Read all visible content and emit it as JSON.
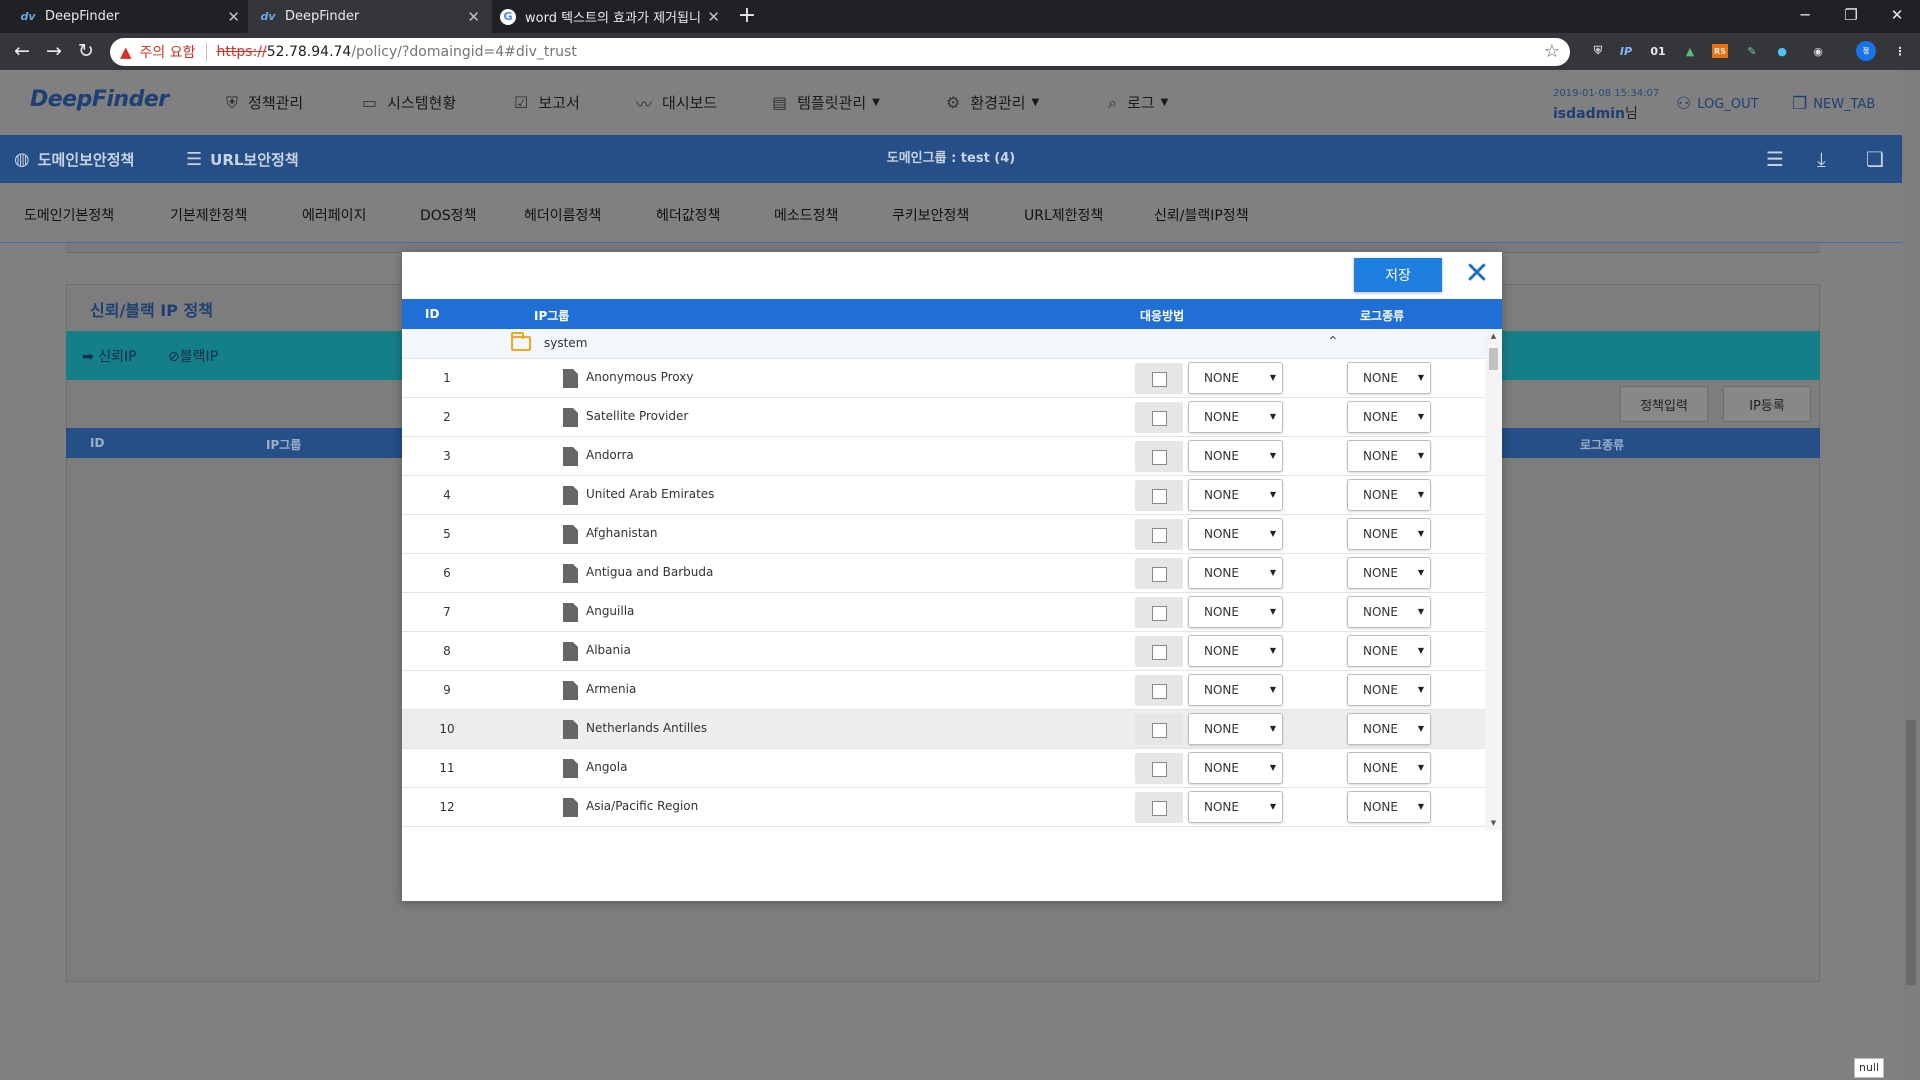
{
  "browser": {
    "tabs": [
      {
        "title": "DeepFinder",
        "favicon": "deepfinder-favicon",
        "active": false
      },
      {
        "title": "DeepFinder",
        "favicon": "deepfinder-favicon",
        "active": true
      },
      {
        "title": "word 텍스트의 효과가 제거됩니",
        "favicon": "google-favicon",
        "active": false
      }
    ],
    "security_warning": "주의 요함",
    "url_protocol": "https://",
    "url_host": "52.78.94.74",
    "url_path": "/policy/?domaingid=4#div_trust",
    "extensions": [
      "1",
      "IP",
      "01"
    ]
  },
  "app": {
    "logo": "DeepFinder",
    "nav": [
      {
        "label": "정책관리",
        "icon": "shield-icon"
      },
      {
        "label": "시스템현황",
        "icon": "monitor-icon"
      },
      {
        "label": "보고서",
        "icon": "clipboard-icon"
      },
      {
        "label": "대시보드",
        "icon": "chart-line-icon"
      },
      {
        "label": "템플릿관리",
        "icon": "template-icon",
        "dropdown": true
      },
      {
        "label": "환경관리",
        "icon": "gear-icon",
        "dropdown": true
      },
      {
        "label": "로그",
        "icon": "search-icon",
        "dropdown": true
      }
    ],
    "datetime": "2019-01-08 15:34:07",
    "username": "isdadmin",
    "user_suffix": "님",
    "logout_label": "LOG_OUT",
    "newtab_label": "NEW_TAB"
  },
  "subbar": {
    "domain_security": "도메인보안정책",
    "url_security": "URL보안정책",
    "domain_group": "도메인그룹 : test (4)"
  },
  "policy_tabs": [
    "도메인기본정책",
    "기본제한정책",
    "에러페이지",
    "DOS정책",
    "헤더이름정책",
    "헤더값정책",
    "메소드정책",
    "쿠키보안정책",
    "URL제한정책",
    "신뢰/블랙IP정책"
  ],
  "background": {
    "panel_title": "신뢰/블랙 IP 정책",
    "trust_tab": "신뢰IP",
    "black_tab": "블랙IP",
    "btn_policy_input": "정책입력",
    "btn_ip_register": "IP등록",
    "col_id": "ID",
    "col_ipgroup": "IP그룹",
    "col_logtype": "로그종류",
    "null_label": "null"
  },
  "modal": {
    "save_label": "저장",
    "columns": {
      "id": "ID",
      "ipgroup": "IP그룹",
      "response": "대응방법",
      "logtype": "로그종류"
    },
    "group_name": "system",
    "rows": [
      {
        "id": "1",
        "name": "Anonymous Proxy",
        "response": "NONE",
        "log": "NONE"
      },
      {
        "id": "2",
        "name": "Satellite Provider",
        "response": "NONE",
        "log": "NONE"
      },
      {
        "id": "3",
        "name": "Andorra",
        "response": "NONE",
        "log": "NONE"
      },
      {
        "id": "4",
        "name": "United Arab Emirates",
        "response": "NONE",
        "log": "NONE"
      },
      {
        "id": "5",
        "name": "Afghanistan",
        "response": "NONE",
        "log": "NONE"
      },
      {
        "id": "6",
        "name": "Antigua and Barbuda",
        "response": "NONE",
        "log": "NONE"
      },
      {
        "id": "7",
        "name": "Anguilla",
        "response": "NONE",
        "log": "NONE"
      },
      {
        "id": "8",
        "name": "Albania",
        "response": "NONE",
        "log": "NONE"
      },
      {
        "id": "9",
        "name": "Armenia",
        "response": "NONE",
        "log": "NONE"
      },
      {
        "id": "10",
        "name": "Netherlands Antilles",
        "response": "NONE",
        "log": "NONE"
      },
      {
        "id": "11",
        "name": "Angola",
        "response": "NONE",
        "log": "NONE"
      },
      {
        "id": "12",
        "name": "Asia/Pacific Region",
        "response": "NONE",
        "log": "NONE"
      }
    ]
  }
}
